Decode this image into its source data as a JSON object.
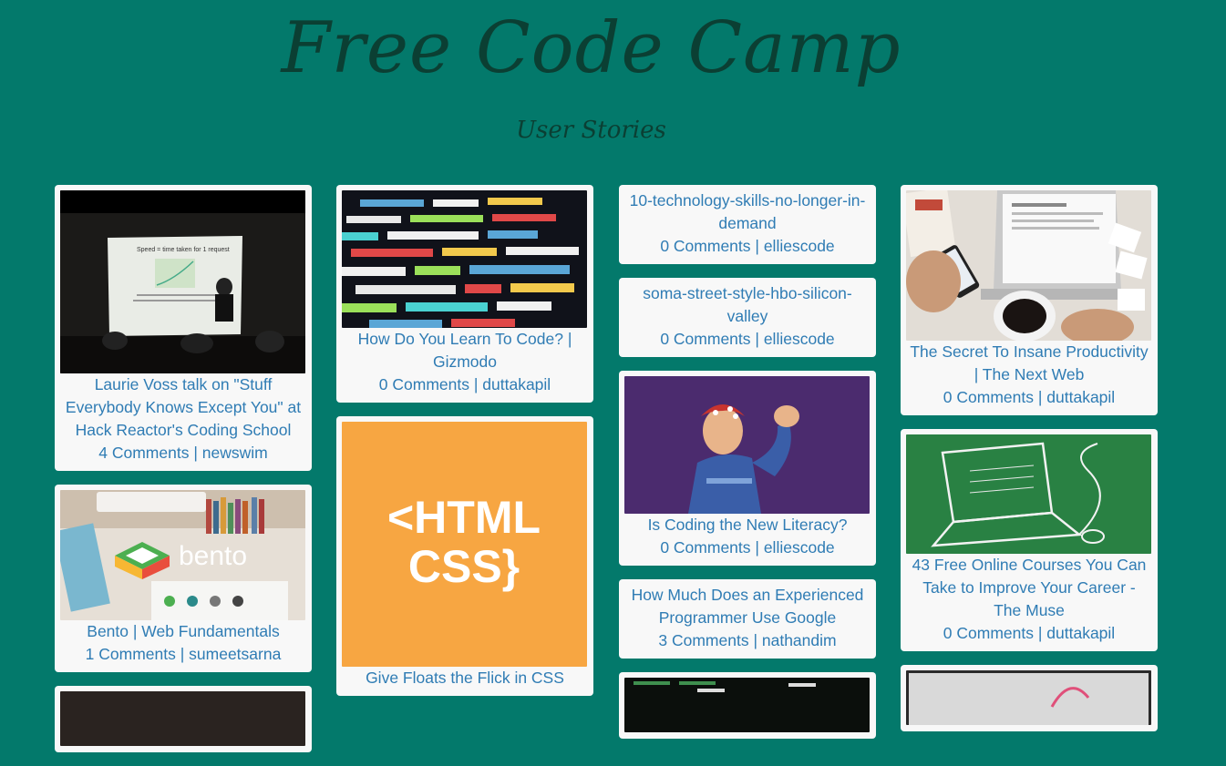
{
  "header": {
    "title": "Free Code Camp",
    "subtitle": "User Stories"
  },
  "separator": "|",
  "cards": {
    "c1": {
      "headline": "Laurie Voss talk on \"Stuff Everybody Knows Except You\" at Hack Reactor's Coding School",
      "comments": "4 Comments",
      "author": "newswim",
      "slide_text": "Speed = time taken for 1 request"
    },
    "c2": {
      "headline": "Bento | Web Fundamentals",
      "comments": "1 Comments",
      "author": "sumeetsarna",
      "logo_text": "bento"
    },
    "c3": {
      "headline": "How Do You Learn To Code? | Gizmodo",
      "comments": "0 Comments",
      "author": "duttakapil"
    },
    "c4": {
      "headline": "Give Floats the Flick in CSS",
      "logo_line1": "<HTML",
      "logo_line2": "CSS}"
    },
    "c5": {
      "headline": "10-technology-skills-no-longer-in-demand",
      "comments": "0 Comments",
      "author": "elliescode"
    },
    "c6": {
      "headline": "soma-street-style-hbo-silicon-valley",
      "comments": "0 Comments",
      "author": "elliescode"
    },
    "c7": {
      "headline": "Is Coding the New Literacy?",
      "comments": "0 Comments",
      "author": "elliescode"
    },
    "c8": {
      "headline": "How Much Does an Experienced Programmer Use Google",
      "comments": "3 Comments",
      "author": "nathandim"
    },
    "c9": {
      "headline": "The Secret To Insane Productivity | The Next Web",
      "comments": "0 Comments",
      "author": "duttakapil"
    },
    "c10": {
      "headline": "43 Free Online Courses You Can Take to Improve Your Career - The Muse",
      "comments": "0 Comments",
      "author": "duttakapil"
    }
  },
  "colors": {
    "background": "#03796b",
    "title": "#0b3f33",
    "link": "#2f7cb4",
    "card": "#f8f8f8"
  }
}
